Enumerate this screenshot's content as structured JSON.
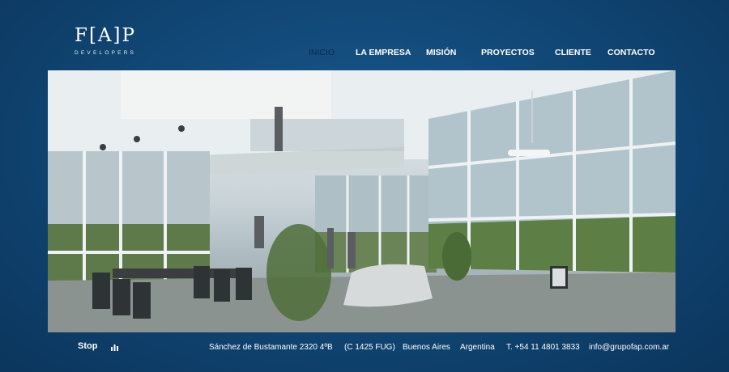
{
  "logo": {
    "mark": "F[A]P",
    "tagline": "DEVELOPERS"
  },
  "nav": {
    "items": [
      {
        "label": "INICIO",
        "active": true
      },
      {
        "label": "LA EMPRESA"
      },
      {
        "label": "MISIÓN"
      },
      {
        "label": "PROYECTOS"
      },
      {
        "label": "CLIENTE"
      },
      {
        "label": "CONTACTO"
      }
    ]
  },
  "slideshow": {
    "control_label": "Stop",
    "control_icon": "audio-bars-icon"
  },
  "contact": {
    "address": "Sánchez de Bustamante 2320 4ºB",
    "postal": "(C 1425 FUG)",
    "city": "Buenos Aires",
    "country": "Argentina",
    "phone": "T. +54 11  4801 3833",
    "email": "info@grupofap.com.ar"
  },
  "colors": {
    "background": "#124a7a",
    "active_nav": "#0c2c4b",
    "text": "#ffffff"
  }
}
